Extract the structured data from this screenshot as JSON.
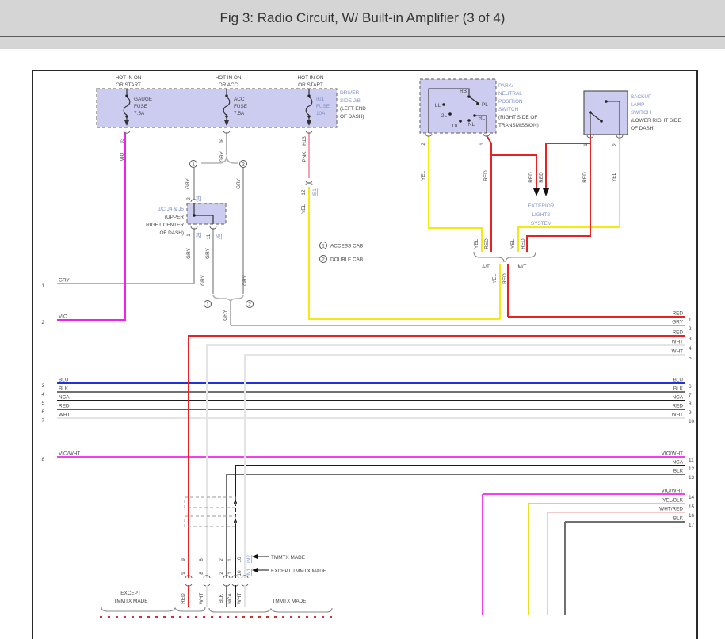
{
  "title": "Fig 3: Radio Circuit, W/ Built-in Amplifier (3 of 4)",
  "colors": {
    "VIO": "#ee22ee",
    "GRY": "#b3b3b3",
    "PNK": "#f4a0b5",
    "YEL": "#f5e913",
    "RED": "#e82222",
    "BLU": "#2233dd",
    "BLK": "#707070",
    "NCA": "#1c1c1c",
    "WHT": "#e4e4e4",
    "VIO/WHT": "#f23ff2",
    "YEL/BLK": "#e8df20",
    "WHT/RED": "#f3caca"
  },
  "fuse_panel": {
    "headers": [
      {
        "l1": "HOT IN ON",
        "l2": "OR START"
      },
      {
        "l1": "HOT IN ON",
        "l2": "OR ACC"
      },
      {
        "l1": "HOT IN ON",
        "l2": "OR START"
      }
    ],
    "fuses": [
      {
        "n1": "GAUGE",
        "n2": "FUSE",
        "n3": "7.5A",
        "pin": "J3",
        "wire": "VIO",
        "blue": false
      },
      {
        "n1": "ACC",
        "n2": "FUSE",
        "n3": "7.5A",
        "pin": "J6",
        "wire": "GRY",
        "blue": false
      },
      {
        "n1": "IG1",
        "n2": "FUSE",
        "n3": "10A",
        "pin": "H13",
        "wire": "PNK",
        "blue": true
      }
    ],
    "name_blue1": "DRIVER",
    "name_blue2": "SIDE J/B",
    "loc1": "(LEFT END",
    "loc2": "OF DASH)"
  },
  "ie1": {
    "pin": "12",
    "conn": "IE1",
    "wire": "YEL"
  },
  "jc": {
    "name": "J/C J4 & J5",
    "loc1": "(UPPER",
    "loc2": "RIGHT CENTER",
    "loc3": "OF DASH)",
    "top_pin": "2",
    "top_conn": "J4",
    "bot_pin1": "1",
    "bot_conn1": "J4",
    "bot_pin2": "11",
    "bot_conn2": "J5",
    "wire": "GRY",
    "circ1": "1",
    "circ2": "2"
  },
  "legend": [
    {
      "sym": "1",
      "label": "ACCESS CAB"
    },
    {
      "sym": "2",
      "label": "DOUBLE CAB"
    }
  ],
  "pnp": {
    "name1": "PARK/",
    "name2": "NEUTRAL",
    "name3": "POSITION",
    "name4": "SWITCH",
    "loc1": "(RIGHT SIDE OF",
    "loc2": "TRANSMISSION)",
    "terminals": [
      "RB",
      "LL",
      "PL",
      "2L",
      "RL",
      "DL",
      "NL"
    ],
    "pin_left": "2",
    "pin_right": "1",
    "wire_left": "YEL",
    "wire_right": "RED"
  },
  "backup": {
    "name1": "BACKUP",
    "name2": "LAMP",
    "name3": "SWITCH",
    "loc1": "(LOWER RIGHT SIDE",
    "loc2": "OF DASH)",
    "pin_left": "1",
    "pin_right": "2",
    "wire_left": "RED",
    "wire_right": "YEL"
  },
  "exterior": {
    "l1": "EXTERIOR",
    "l2": "LIGHTS",
    "l3": "SYSTEM",
    "wire1": "RED",
    "wire2": "RED"
  },
  "trans": {
    "at": "A/T",
    "mt": "M/T",
    "at_wires": [
      "YEL",
      "RED"
    ],
    "mt_wires": [
      "YEL",
      "RED"
    ],
    "out_wires": [
      "YEL",
      "RED"
    ]
  },
  "left_rows": [
    {
      "n": "1",
      "label": "GRY"
    },
    {
      "n": "2",
      "label": "VIO"
    },
    {
      "n": "3",
      "label": "BLU"
    },
    {
      "n": "4",
      "label": "BLK"
    },
    {
      "n": "5",
      "label": "NCA"
    },
    {
      "n": "6",
      "label": "RED"
    },
    {
      "n": "7",
      "label": "WHT"
    },
    {
      "n": "8",
      "label": "VIO/WHT"
    }
  ],
  "right_rows": [
    {
      "n": "1",
      "label": "RED"
    },
    {
      "n": "2",
      "label": "GRY"
    },
    {
      "n": "3",
      "label": "RED"
    },
    {
      "n": "4",
      "label": "WHT"
    },
    {
      "n": "5",
      "label": "WHT"
    },
    {
      "n": "6",
      "label": "BLU"
    },
    {
      "n": "7",
      "label": "BLK"
    },
    {
      "n": "8",
      "label": "NCA"
    },
    {
      "n": "9",
      "label": "RED"
    },
    {
      "n": "10",
      "label": "WHT"
    },
    {
      "n": "11",
      "label": "VIO/WHT"
    },
    {
      "n": "12",
      "label": "NCA"
    },
    {
      "n": "13",
      "label": "BLK"
    },
    {
      "n": "14",
      "label": "VIO/WHT"
    },
    {
      "n": "15",
      "label": "YEL/BLK"
    },
    {
      "n": "16",
      "label": "WHT/RED"
    },
    {
      "n": "17",
      "label": "BLK"
    }
  ],
  "bottom": {
    "columns": [
      {
        "wire": "RED",
        "pin": "9"
      },
      {
        "wire": "WHT",
        "pin": "8"
      },
      {
        "wire": "BLK",
        "pin": "2"
      },
      {
        "wire": "NCA",
        "pin": "1"
      },
      {
        "wire": "WHT",
        "pin": "10"
      }
    ],
    "in2": {
      "conn": "IN2",
      "note": "TMMTX MADE"
    },
    "in1": {
      "conn": "IN1",
      "note": "EXCEPT TMMTX MADE"
    },
    "group_left1": "EXCEPT",
    "group_left2": "TMMTX MADE",
    "group_right": "TMMTX MADE"
  }
}
